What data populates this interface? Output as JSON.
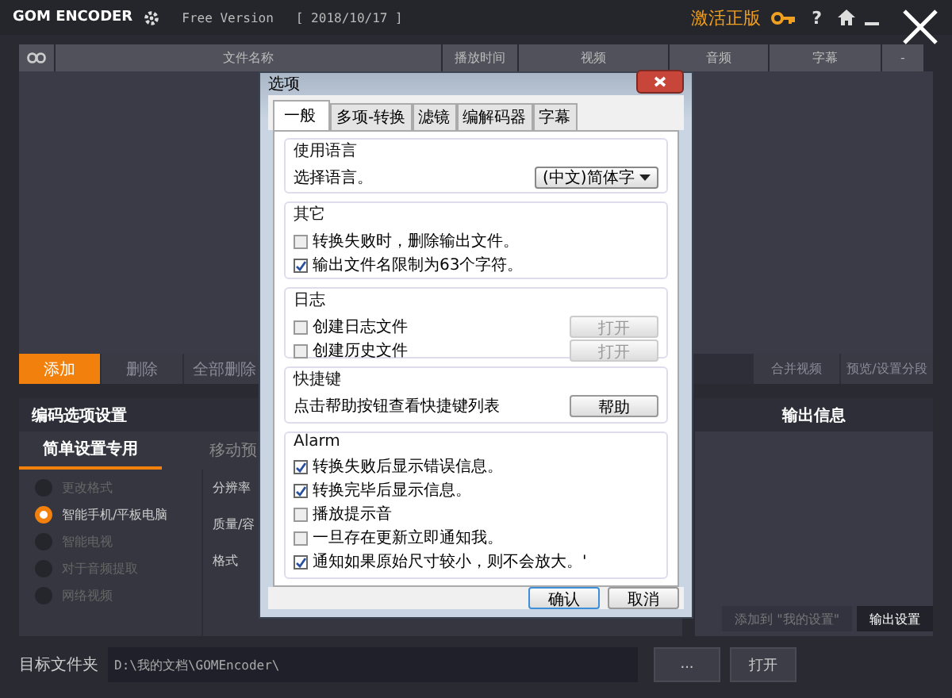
{
  "title_bar": {
    "logo": "GOM ENCODER",
    "edition": "Free Version",
    "date": "[ 2018/10/17 ]",
    "activate": "激活正版",
    "help": "?"
  },
  "table": {
    "columns": [
      "文件名称",
      "播放时间",
      "视频",
      "音频",
      "字幕",
      "-"
    ]
  },
  "file_buttons": [
    {
      "label": "添加",
      "selected": true
    },
    {
      "label": "删除",
      "selected": false
    },
    {
      "label": "全部删除",
      "selected": false
    }
  ],
  "merge_buttons": [
    "合并视频",
    "预览/设置分段"
  ],
  "encoding_panel": {
    "title": "编码选项设置",
    "tabs": [
      {
        "label": "简单设置专用",
        "selected": true
      },
      {
        "label": "移动预",
        "selected": false
      }
    ],
    "presets": [
      {
        "label": "更改格式",
        "selected": false
      },
      {
        "label": "智能手机/平板电脑",
        "selected": true
      },
      {
        "label": "智能电视",
        "selected": false
      },
      {
        "label": "对于音频提取",
        "selected": false
      },
      {
        "label": "网络视频",
        "selected": false
      }
    ],
    "fields": [
      "分辨率",
      "质量/容",
      "格式"
    ]
  },
  "output_panel": {
    "title": "输出信息",
    "buttons": [
      {
        "label": "添加到 \"我的设置\"",
        "disabled": true
      },
      {
        "label": "输出设置",
        "disabled": false
      }
    ]
  },
  "target_folder": {
    "label": "目标文件夹",
    "path": "D:\\我的文档\\GOMEncoder\\",
    "browse": "...",
    "open": "打开"
  },
  "dialog": {
    "title": "选项",
    "tabs": [
      {
        "label": "一般",
        "selected": true
      },
      {
        "label": "多项-转换",
        "selected": false
      },
      {
        "label": "滤镜",
        "selected": false
      },
      {
        "label": "编解码器",
        "selected": false
      },
      {
        "label": "字幕",
        "selected": false
      }
    ],
    "groups": [
      {
        "title": "使用语言",
        "kind": "select",
        "label": "选择语言。",
        "value": "(中文)简体字"
      },
      {
        "title": "其它",
        "kind": "checks",
        "items": [
          {
            "label": "转换失败时，删除输出文件。",
            "checked": false
          },
          {
            "label": "输出文件名限制为63个字符。",
            "checked": true
          }
        ]
      },
      {
        "title": "日志",
        "kind": "checks",
        "items": [
          {
            "label": "创建日志文件",
            "checked": false,
            "button": "打开",
            "disabled": true
          },
          {
            "label": "创建历史文件",
            "checked": false,
            "button": "打开",
            "disabled": true
          }
        ]
      },
      {
        "title": "快捷键",
        "kind": "help",
        "label": "点击帮助按钮查看快捷键列表",
        "button": "帮助"
      },
      {
        "title": "Alarm",
        "kind": "checks",
        "items": [
          {
            "label": "转换失败后显示错误信息。",
            "checked": true
          },
          {
            "label": "转换完毕后显示信息。",
            "checked": true
          },
          {
            "label": "播放提示音",
            "checked": false
          },
          {
            "label": "一旦存在更新立即通知我。",
            "checked": false
          },
          {
            "label": "通知如果原始尺寸较小，则不会放大。'",
            "checked": true
          }
        ]
      }
    ],
    "buttons": [
      {
        "label": "确认",
        "default": true
      },
      {
        "label": "取消",
        "default": false
      }
    ]
  }
}
